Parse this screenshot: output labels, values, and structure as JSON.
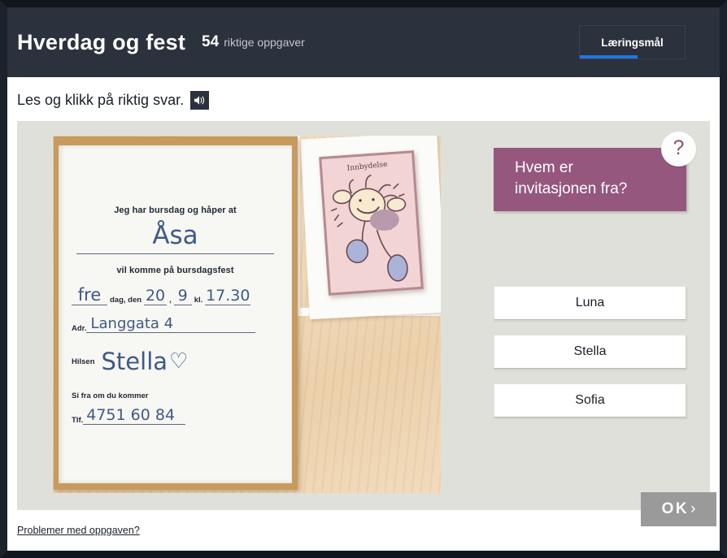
{
  "header": {
    "title": "Hverdag og fest",
    "score_count": "54",
    "score_label": "riktige oppgaver",
    "goal_button_label": "Læringsmål",
    "goal_progress_percent": 55,
    "background_color": "#2b313d",
    "accent_color": "#1f76e0"
  },
  "instruction": {
    "text": "Les og klikk på riktig svar.",
    "audio_icon": "speaker-icon"
  },
  "task": {
    "panel_color": "#dfe0da",
    "question": {
      "text": "Hvem er\ninvitasjonen fra?",
      "background_color": "#96577e"
    },
    "help": {
      "label": "?",
      "icon": "question-mark-icon"
    },
    "answers": [
      {
        "label": "Luna"
      },
      {
        "label": "Stella"
      },
      {
        "label": "Sofia"
      }
    ],
    "ok_button": {
      "label": "OK",
      "chevron": "›",
      "background_color": "#9a9a9a"
    },
    "illustration": {
      "alt": "photo-of-birthday-invitation-on-wooden-table",
      "invitation_card": {
        "line_1": "Jeg har bursdag og håper at",
        "name_handwritten": "Åsa",
        "line_2": "vil komme på bursdagsfest",
        "day_handwritten": "fre",
        "day_label": "dag, den",
        "date_day": "20",
        "date_separator": ",",
        "date_month": "9",
        "time_label": "kl.",
        "time": "17.30",
        "address_label": "Adr.",
        "address": "Langgata 4",
        "greeting_label": "Hilsen",
        "greeting_name": "Stella",
        "greeting_symbol": "♡",
        "rsvp_line": "Si fra om du kommer",
        "phone_label": "Tlf.",
        "phone": "4751 60 84"
      },
      "pink_card": {
        "title": "Innbydelse"
      }
    }
  },
  "footer": {
    "problem_link": "Problemer med oppgaven?"
  }
}
